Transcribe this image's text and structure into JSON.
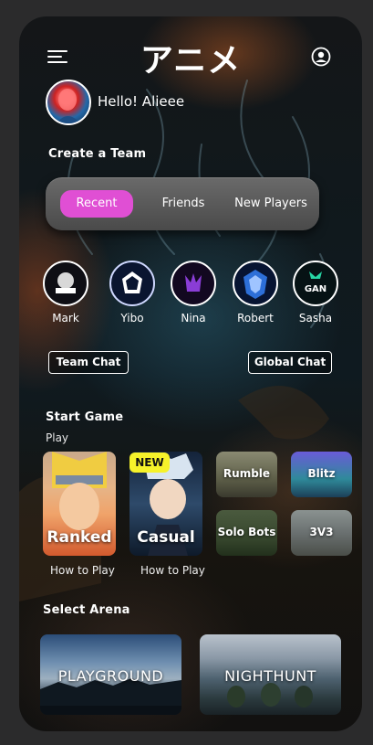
{
  "app": {
    "title": "アニメ"
  },
  "header": {
    "menu_icon": "hamburger-icon",
    "profile_icon": "profile-icon"
  },
  "user": {
    "greeting": "Hello! Alieee"
  },
  "team": {
    "heading": "Create a Team",
    "tabs": [
      {
        "label": "Recent",
        "active": true
      },
      {
        "label": "Friends",
        "active": false
      },
      {
        "label": "New Players",
        "active": false
      }
    ],
    "friends": [
      {
        "name": "Mark"
      },
      {
        "name": "Yibo"
      },
      {
        "name": "Nina"
      },
      {
        "name": "Robert"
      },
      {
        "name": "Sasha",
        "logo_text": "GAN"
      }
    ],
    "team_chat": "Team Chat",
    "global_chat": "Global Chat"
  },
  "game": {
    "heading": "Start Game",
    "subheading": "Play",
    "modes": [
      {
        "title": "Ranked",
        "link": "How to Play"
      },
      {
        "title": "Casual",
        "badge": "NEW",
        "link": "How to Play"
      }
    ],
    "tiles": [
      {
        "title": "Rumble"
      },
      {
        "title": "Blitz"
      },
      {
        "title": "Solo Bots"
      },
      {
        "title": "3V3"
      }
    ]
  },
  "arena": {
    "heading": "Select Arena",
    "items": [
      {
        "title": "PLAYGROUND"
      },
      {
        "title": "NIGHTHUNT"
      }
    ]
  },
  "colors": {
    "accent": "#e04fd4",
    "badge": "#f6f22a",
    "background": "#2b2b2c"
  }
}
